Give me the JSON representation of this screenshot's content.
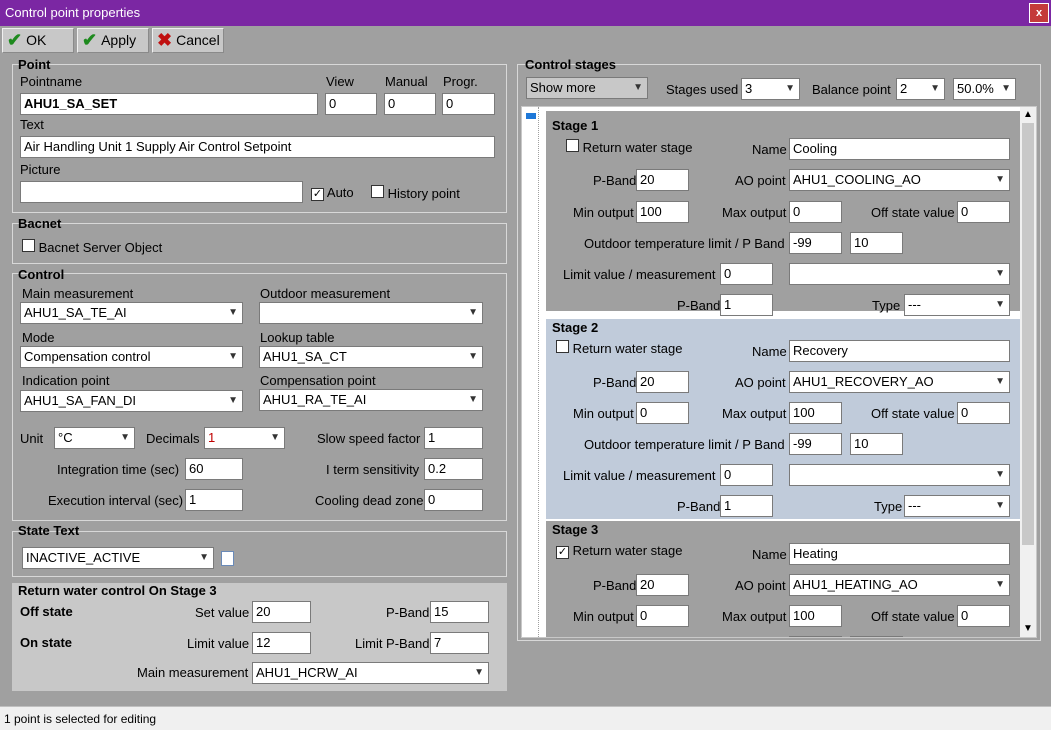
{
  "window": {
    "title": "Control point properties",
    "close_label": "x"
  },
  "toolbar": {
    "ok": "OK",
    "apply": "Apply",
    "cancel": "Cancel"
  },
  "point": {
    "section": "Point",
    "pointname_label": "Pointname",
    "pointname_value": "AHU1_SA_SET",
    "view_label": "View",
    "view_value": "0",
    "manual_label": "Manual",
    "manual_value": "0",
    "progr_label": "Progr.",
    "progr_value": "0",
    "text_label": "Text",
    "text_value": "Air Handling Unit 1 Supply Air Control Setpoint",
    "picture_label": "Picture",
    "picture_value": "",
    "auto_label": "Auto",
    "auto_checked": "✓",
    "history_label": "History point"
  },
  "bacnet": {
    "section": "Bacnet",
    "server_label": "Bacnet Server Object"
  },
  "control": {
    "section": "Control",
    "main_meas_label": "Main measurement",
    "main_meas_value": "AHU1_SA_TE_AI",
    "outdoor_meas_label": "Outdoor measurement",
    "outdoor_meas_value": "",
    "mode_label": "Mode",
    "mode_value": "Compensation control",
    "lookup_label": "Lookup table",
    "lookup_value": "AHU1_SA_CT",
    "indication_label": "Indication point",
    "indication_value": "AHU1_SA_FAN_DI",
    "compensation_label": "Compensation point",
    "compensation_value": "AHU1_RA_TE_AI",
    "unit_label": "Unit",
    "unit_value": "°C",
    "decimals_label": "Decimals",
    "decimals_value": "1",
    "slow_label": "Slow speed factor",
    "slow_value": "1",
    "integration_label": "Integration time (sec)",
    "integration_value": "60",
    "iterm_label": "I term sensitivity",
    "iterm_value": "0.2",
    "exec_label": "Execution interval (sec)",
    "exec_value": "1",
    "cooling_dz_label": "Cooling dead zone",
    "cooling_dz_value": "0"
  },
  "state_text": {
    "section": "State Text",
    "value": "INACTIVE_ACTIVE"
  },
  "return_water": {
    "section": "Return water control On Stage 3",
    "off_state": "Off state",
    "on_state": "On state",
    "set_label": "Set value",
    "set_value": "20",
    "pband_label": "P-Band",
    "pband_value": "15",
    "limit_label": "Limit value",
    "limit_value": "12",
    "limit_pband_label": "Limit P-Band",
    "limit_pband_value": "7",
    "main_meas_label": "Main measurement",
    "main_meas_value": "AHU1_HCRW_AI"
  },
  "stages_panel": {
    "section": "Control stages",
    "show_more": "Show more",
    "stages_used_label": "Stages used",
    "stages_used_value": "3",
    "balance_label": "Balance point",
    "balance_value": "2",
    "balance_pct": "50.0%"
  },
  "stage_labels": {
    "return_water": "Return water stage",
    "name": "Name",
    "pband": "P-Band",
    "ao_point": "AO point",
    "min_output": "Min output",
    "max_output": "Max output",
    "off_state_value": "Off state value",
    "outdoor_limit": "Outdoor temperature limit / P Band",
    "limit_meas": "Limit value / measurement",
    "type": "Type"
  },
  "stages": [
    {
      "title": "Stage 1",
      "return_checked": "",
      "name": "Cooling",
      "pband": "20",
      "ao_point": "AHU1_COOLING_AO",
      "min": "100",
      "max": "0",
      "off": "0",
      "outdoor_limit": "-99",
      "outdoor_pband": "10",
      "limit_value": "0",
      "limit_meas": "",
      "pband2": "1",
      "type": "---"
    },
    {
      "title": "Stage 2",
      "return_checked": "",
      "name": "Recovery",
      "pband": "20",
      "ao_point": "AHU1_RECOVERY_AO",
      "min": "0",
      "max": "100",
      "off": "0",
      "outdoor_limit": "-99",
      "outdoor_pband": "10",
      "limit_value": "0",
      "limit_meas": "",
      "pband2": "1",
      "type": "---"
    },
    {
      "title": "Stage 3",
      "return_checked": "✓",
      "name": "Heating",
      "pband": "20",
      "ao_point": "AHU1_HEATING_AO",
      "min": "0",
      "max": "100",
      "off": "0"
    }
  ],
  "status": {
    "text": "1 point is selected for editing"
  },
  "colors": {
    "titlebar": "#7b27a3",
    "stage2_bg": "#c0cbda"
  }
}
